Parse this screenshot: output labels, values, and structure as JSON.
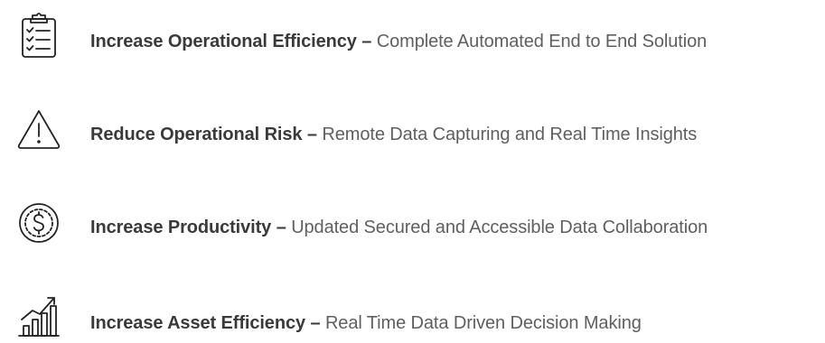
{
  "benefits": [
    {
      "icon": "clipboard-checklist-icon",
      "title": "Increase Operational Efficiency",
      "separator": "–",
      "description": "Complete Automated End to End Solution"
    },
    {
      "icon": "warning-triangle-icon",
      "title": "Reduce Operational Risk",
      "separator": "–",
      "description": "Remote Data Capturing and Real Time Insights"
    },
    {
      "icon": "dollar-coin-icon",
      "title": "Increase Productivity",
      "separator": "–",
      "description": "Updated Secured and Accessible Data Collaboration"
    },
    {
      "icon": "growth-chart-icon",
      "title": "Increase Asset Efficiency",
      "separator": "–",
      "description": "Real Time Data Driven Decision Making"
    }
  ],
  "colors": {
    "title": "#3a3a3a",
    "description": "#5f5f5f",
    "icon_stroke": "#222222"
  }
}
